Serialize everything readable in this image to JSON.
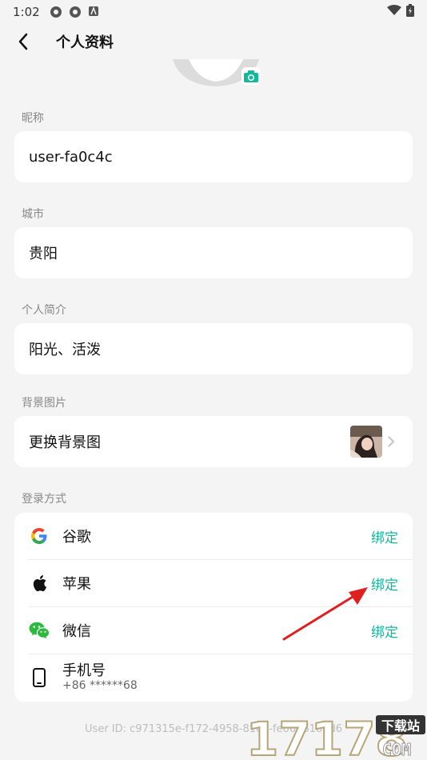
{
  "status_bar": {
    "time": "1:02"
  },
  "header": {
    "title": "个人资料"
  },
  "nickname": {
    "label": "昵称",
    "value": "user-fa0c4c"
  },
  "city": {
    "label": "城市",
    "value": "贵阳"
  },
  "bio": {
    "label": "个人简介",
    "value": "阳光、活泼"
  },
  "background": {
    "label": "背景图片",
    "action": "更换背景图"
  },
  "login": {
    "label": "登录方式",
    "items": [
      {
        "name": "谷歌",
        "icon": "google-icon",
        "action": "绑定"
      },
      {
        "name": "苹果",
        "icon": "apple-icon",
        "action": "绑定"
      },
      {
        "name": "微信",
        "icon": "wechat-icon",
        "action": "绑定"
      },
      {
        "name": "手机号",
        "icon": "phone-icon",
        "sub": "+86 ******68"
      }
    ]
  },
  "footer": {
    "user_id": "User ID: c971315e-f172-4958-810e-fe6656160d6"
  },
  "watermark": {
    "number": "17178",
    "tag": "下载站",
    "domain": "COM"
  },
  "colors": {
    "accent": "#14b89a",
    "background": "#f4f4f4",
    "arrow": "#e02020"
  }
}
